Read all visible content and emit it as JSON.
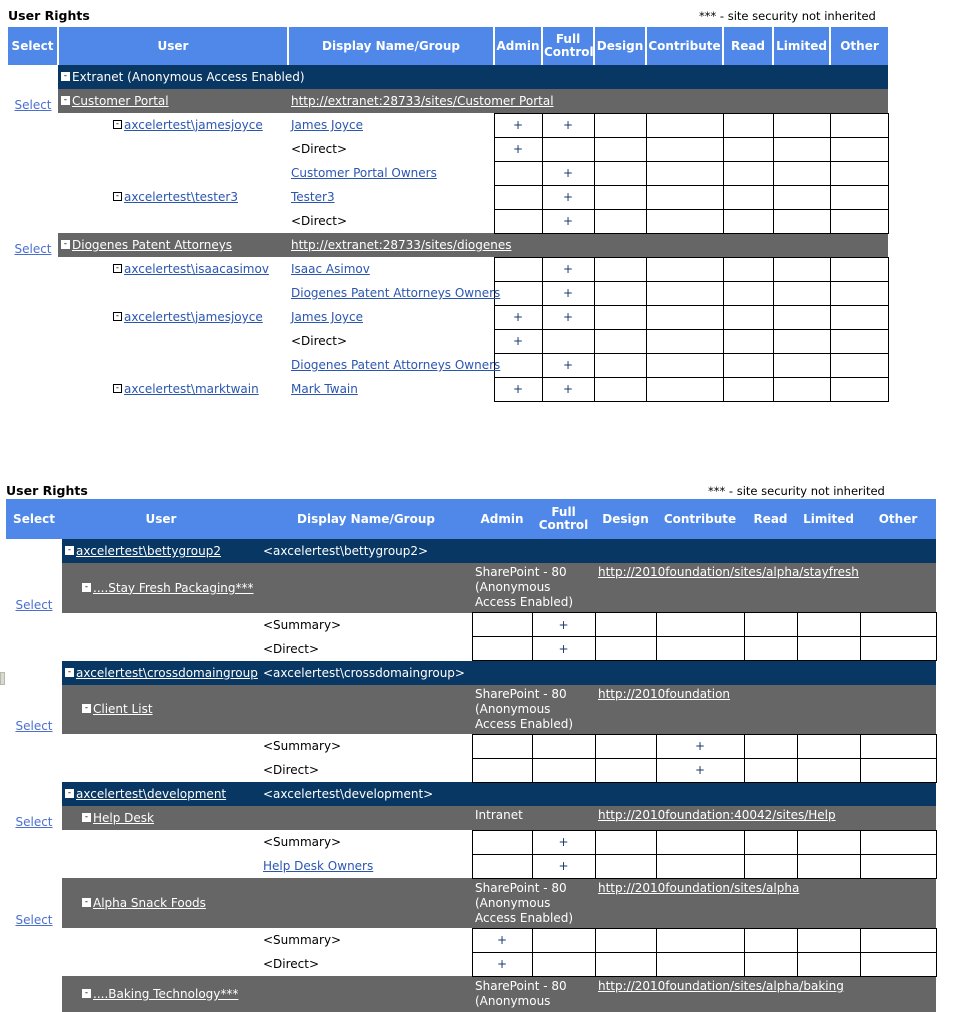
{
  "report1": {
    "title": "User Rights",
    "note": "*** - site security not inherited",
    "columns": [
      "Select",
      "User",
      "Display Name/Group",
      "Admin",
      "Full Control",
      "Design",
      "Contribute",
      "Read",
      "Limited",
      "Other"
    ],
    "select_label": "Select",
    "rows": [
      {
        "kind": "navy",
        "select": "",
        "user": "Extranet (Anonymous Access Enabled)",
        "user_link": false,
        "display": "",
        "display_link": false,
        "marks": []
      },
      {
        "kind": "gray",
        "select": "Select",
        "user": "Customer Portal",
        "user_link": true,
        "display": "http://extranet:28733/sites/Customer Portal",
        "display_link": true,
        "marks": []
      },
      {
        "kind": "data",
        "select": "",
        "user": "axcelertest\\jamesjoyce",
        "user_link": true,
        "indent": 1,
        "display": "James Joyce",
        "display_link": true,
        "marks": [
          "+",
          "+",
          "",
          "",
          "",
          "",
          ""
        ]
      },
      {
        "kind": "data",
        "select": "",
        "user": "",
        "user_link": false,
        "indent": 1,
        "display": "<Direct>",
        "display_link": false,
        "marks": [
          "+",
          "",
          "",
          "",
          "",
          "",
          ""
        ]
      },
      {
        "kind": "data",
        "select": "",
        "user": "",
        "user_link": false,
        "indent": 1,
        "display": "Customer Portal Owners",
        "display_link": true,
        "marks": [
          "",
          "+",
          "",
          "",
          "",
          "",
          ""
        ]
      },
      {
        "kind": "data",
        "select": "",
        "user": "axcelertest\\tester3",
        "user_link": true,
        "indent": 1,
        "display": "Tester3",
        "display_link": true,
        "marks": [
          "",
          "+",
          "",
          "",
          "",
          "",
          ""
        ]
      },
      {
        "kind": "data",
        "select": "",
        "user": "",
        "user_link": false,
        "indent": 1,
        "display": "<Direct>",
        "display_link": false,
        "marks": [
          "",
          "+",
          "",
          "",
          "",
          "",
          ""
        ]
      },
      {
        "kind": "gray",
        "select": "Select",
        "user": "Diogenes Patent Attorneys",
        "user_link": true,
        "display": "http://extranet:28733/sites/diogenes",
        "display_link": true,
        "marks": []
      },
      {
        "kind": "data",
        "select": "",
        "user": "axcelertest\\isaacasimov",
        "user_link": true,
        "indent": 1,
        "display": "Isaac Asimov",
        "display_link": true,
        "marks": [
          "",
          "+",
          "",
          "",
          "",
          "",
          ""
        ]
      },
      {
        "kind": "data",
        "select": "",
        "user": "",
        "user_link": false,
        "indent": 1,
        "display": "Diogenes Patent Attorneys Owners",
        "display_link": true,
        "marks": [
          "",
          "+",
          "",
          "",
          "",
          "",
          ""
        ]
      },
      {
        "kind": "data",
        "select": "",
        "user": "axcelertest\\jamesjoyce",
        "user_link": true,
        "indent": 1,
        "display": "James Joyce",
        "display_link": true,
        "marks": [
          "+",
          "+",
          "",
          "",
          "",
          "",
          ""
        ]
      },
      {
        "kind": "data",
        "select": "",
        "user": "",
        "user_link": false,
        "indent": 1,
        "display": "<Direct>",
        "display_link": false,
        "marks": [
          "+",
          "",
          "",
          "",
          "",
          "",
          ""
        ]
      },
      {
        "kind": "data",
        "select": "",
        "user": "",
        "user_link": false,
        "indent": 1,
        "display": "Diogenes Patent Attorneys Owners",
        "display_link": true,
        "marks": [
          "",
          "+",
          "",
          "",
          "",
          "",
          ""
        ]
      },
      {
        "kind": "data",
        "select": "",
        "user": "axcelertest\\marktwain",
        "user_link": true,
        "indent": 1,
        "display": "Mark Twain",
        "display_link": true,
        "marks": [
          "+",
          "+",
          "",
          "",
          "",
          "",
          ""
        ]
      }
    ]
  },
  "report2": {
    "title": "User Rights",
    "note": "*** - site security not inherited",
    "columns": [
      "Select",
      "User",
      "Display Name/Group",
      "Admin",
      "Full Control",
      "Design",
      "Contribute",
      "Read",
      "Limited",
      "Other"
    ],
    "select_label": "Select",
    "rows": [
      {
        "kind": "navy",
        "select": "",
        "user": "axcelertest\\bettygroup2",
        "user_link": true,
        "indent": 1,
        "display": "<axcelertest\\bettygroup2>",
        "display_link": false,
        "col4": "",
        "col5": "",
        "marks": []
      },
      {
        "kind": "gray",
        "select": "Select",
        "user": "....Stay Fresh Packaging***",
        "user_link": true,
        "indent": 2,
        "display": "",
        "display_link": false,
        "col4": "SharePoint - 80 (Anonymous Access Enabled)",
        "col5": "http://2010foundation/sites/alpha/stayfresh",
        "col5_link": true,
        "marks": []
      },
      {
        "kind": "data",
        "select": "",
        "user": "",
        "user_link": false,
        "display": "<Summary>",
        "display_link": false,
        "marks": [
          "",
          "+",
          "",
          "",
          "",
          "",
          ""
        ]
      },
      {
        "kind": "data",
        "select": "",
        "user": "",
        "user_link": false,
        "display": "<Direct>",
        "display_link": false,
        "marks": [
          "",
          "+",
          "",
          "",
          "",
          "",
          ""
        ]
      },
      {
        "kind": "navy",
        "select": "",
        "user": "axcelertest\\crossdomaingroup",
        "user_link": true,
        "indent": 1,
        "display": "<axcelertest\\crossdomaingroup>",
        "display_link": false,
        "col4": "",
        "col5": "",
        "marks": []
      },
      {
        "kind": "gray",
        "select": "Select",
        "user": "Client List",
        "user_link": true,
        "indent": 2,
        "display": "",
        "display_link": false,
        "col4": "SharePoint - 80 (Anonymous Access Enabled)",
        "col5": "http://2010foundation",
        "col5_link": true,
        "marks": []
      },
      {
        "kind": "data",
        "select": "",
        "user": "",
        "user_link": false,
        "display": "<Summary>",
        "display_link": false,
        "marks": [
          "",
          "",
          "",
          "+",
          "",
          "",
          ""
        ]
      },
      {
        "kind": "data",
        "select": "",
        "user": "",
        "user_link": false,
        "display": "<Direct>",
        "display_link": false,
        "marks": [
          "",
          "",
          "",
          "+",
          "",
          "",
          ""
        ]
      },
      {
        "kind": "navy",
        "select": "",
        "user": "axcelertest\\development",
        "user_link": true,
        "indent": 1,
        "display": "<axcelertest\\development>",
        "display_link": false,
        "col4": "",
        "col5": "",
        "marks": []
      },
      {
        "kind": "gray",
        "select": "Select",
        "user": "Help Desk",
        "user_link": true,
        "indent": 2,
        "display": "",
        "display_link": false,
        "col4": "Intranet",
        "col5": "http://2010foundation:40042/sites/Help",
        "col5_link": true,
        "marks": []
      },
      {
        "kind": "data",
        "select": "",
        "user": "",
        "user_link": false,
        "display": "<Summary>",
        "display_link": false,
        "marks": [
          "",
          "+",
          "",
          "",
          "",
          "",
          ""
        ]
      },
      {
        "kind": "data",
        "select": "",
        "user": "",
        "user_link": false,
        "display": "Help Desk Owners",
        "display_link": true,
        "marks": [
          "",
          "+",
          "",
          "",
          "",
          "",
          ""
        ]
      },
      {
        "kind": "gray",
        "select": "Select",
        "user": "Alpha Snack Foods",
        "user_link": true,
        "indent": 2,
        "display": "",
        "display_link": false,
        "col4": "SharePoint - 80 (Anonymous Access Enabled)",
        "col5": "http://2010foundation/sites/alpha",
        "col5_link": true,
        "marks": []
      },
      {
        "kind": "data",
        "select": "",
        "user": "",
        "user_link": false,
        "display": "<Summary>",
        "display_link": false,
        "marks": [
          "+",
          "",
          "",
          "",
          "",
          "",
          ""
        ]
      },
      {
        "kind": "data",
        "select": "",
        "user": "",
        "user_link": false,
        "display": "<Direct>",
        "display_link": false,
        "marks": [
          "+",
          "",
          "",
          "",
          "",
          "",
          ""
        ]
      },
      {
        "kind": "gray",
        "select": "",
        "user": "....Baking Technology***",
        "user_link": true,
        "indent": 2,
        "display": "",
        "display_link": false,
        "col4": "SharePoint - 80 (Anonymous",
        "col5": "http://2010foundation/sites/alpha/baking",
        "col5_link": true,
        "marks": []
      }
    ]
  },
  "icons": {
    "collapse": "-",
    "expand": "+",
    "mark": "+"
  },
  "colors": {
    "header_blue": "#4f88e8",
    "band_navy": "#083763",
    "band_gray": "#666666",
    "link_blue": "#2b56b0",
    "text_black": "#000000"
  }
}
